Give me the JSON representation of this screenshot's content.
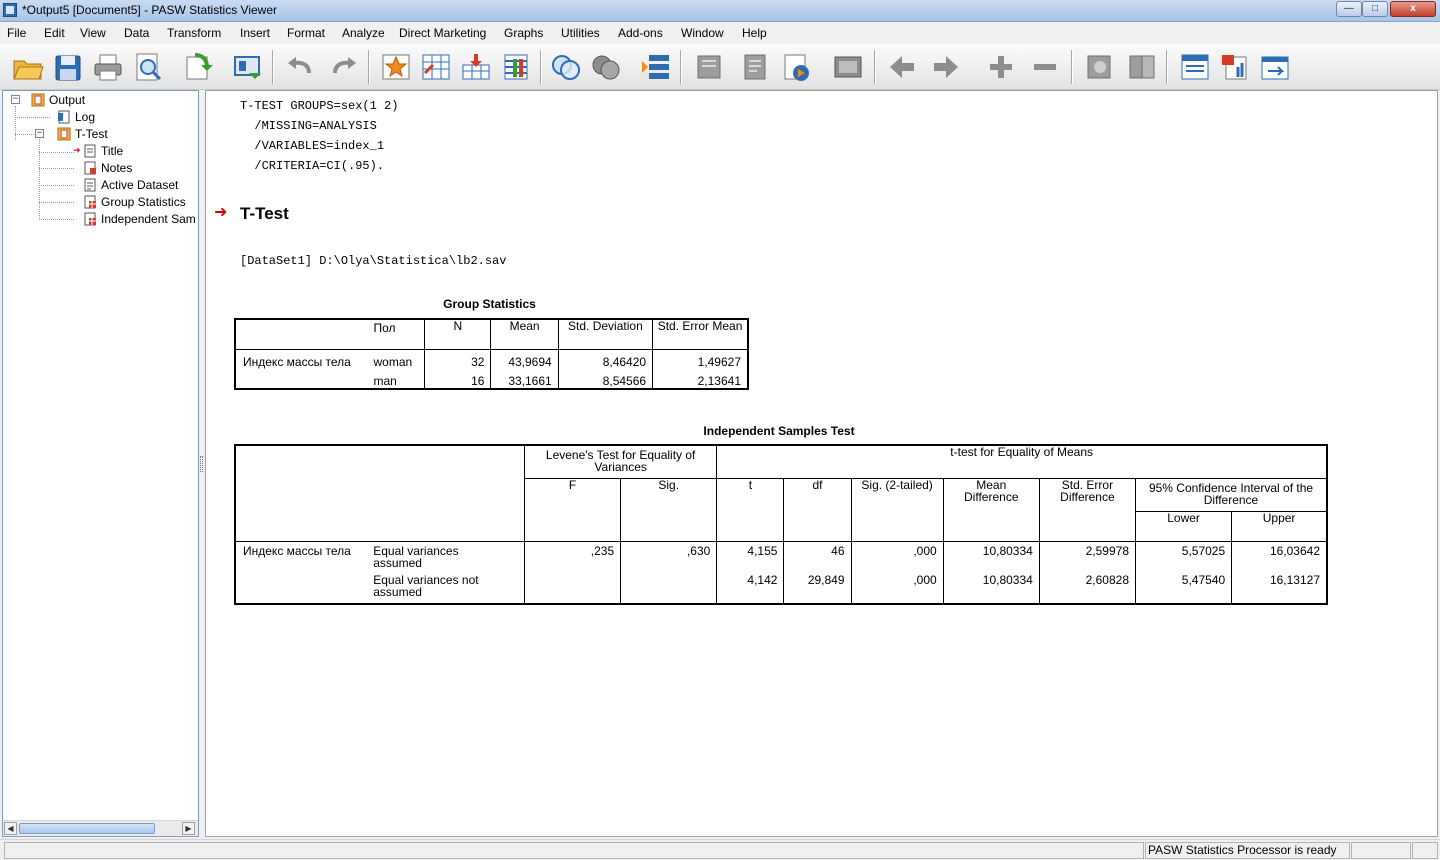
{
  "window": {
    "title": "*Output5 [Document5] - PASW Statistics Viewer",
    "min_glyph": "—",
    "max_glyph": "□",
    "close_glyph": "x"
  },
  "menu": [
    "File",
    "Edit",
    "View",
    "Data",
    "Transform",
    "Insert",
    "Format",
    "Analyze",
    "Direct Marketing",
    "Graphs",
    "Utilities",
    "Add-ons",
    "Window",
    "Help"
  ],
  "toolbar": {
    "icons": [
      "open-icon",
      "save-icon",
      "print-icon",
      "print-preview-icon",
      "export-icon",
      "recall-dialog-icon",
      "undo-icon",
      "redo-icon",
      "goto-data-icon",
      "goto-case-icon",
      "goto-variable-icon",
      "variables-icon",
      "split-file-icon",
      "select-cases-icon",
      "value-labels-icon",
      "custom-dialog-icon",
      "designate-window-icon",
      "promote-icon",
      "demote-icon",
      "expand-icon",
      "collapse-icon",
      "show-icon",
      "hide-icon",
      "insert-heading-icon",
      "insert-title-icon",
      "insert-text-icon"
    ],
    "accent_colors": {
      "orange": "#f08a1c",
      "blue": "#2f6db3",
      "green": "#3c9a32",
      "red": "#d63a2a",
      "gray": "#8d8d8d"
    }
  },
  "outline": {
    "items": [
      {
        "label": "Output",
        "icon": "output-book-icon"
      },
      {
        "label": "Log",
        "icon": "log-icon"
      },
      {
        "label": "T-Test",
        "icon": "procedure-book-icon"
      },
      {
        "label": "Title",
        "icon": "title-icon",
        "current_marker": "➔"
      },
      {
        "label": "Notes",
        "icon": "notes-icon"
      },
      {
        "label": "Active Dataset",
        "icon": "active-dataset-icon"
      },
      {
        "label": "Group Statistics",
        "icon": "table-icon"
      },
      {
        "label": "Independent Sam",
        "icon": "table-icon"
      }
    ],
    "collapse_glyph": "−",
    "scroll_left_glyph": "◀",
    "scroll_right_glyph": "▶"
  },
  "syntax": [
    "T-TEST GROUPS=sex(1 2)",
    "  /MISSING=ANALYSIS",
    "  /VARIABLES=index_1",
    "  /CRITERIA=CI(.95)."
  ],
  "section": {
    "arrow": "➜",
    "title": "T-Test",
    "dataset": "[DataSet1] D:\\Olya\\Statistica\\lb2.sav"
  },
  "group_statistics": {
    "title": "Group Statistics",
    "group_header": "Пол",
    "headers": [
      "N",
      "Mean",
      "Std. Deviation",
      "Std. Error Mean"
    ],
    "row_label": "Индекс массы тела",
    "rows": [
      {
        "group": "woman",
        "n": "32",
        "mean": "43,9694",
        "sd": "8,46420",
        "se": "1,49627"
      },
      {
        "group": "man",
        "n": "16",
        "mean": "33,1661",
        "sd": "8,54566",
        "se": "2,13641"
      }
    ]
  },
  "independent_test": {
    "title": "Independent Samples Test",
    "levene_header": "Levene's Test for Equality of Variances",
    "ttest_header": "t-test for Equality of Means",
    "ci_header": "95% Confidence Interval of the Difference",
    "columns": {
      "f": "F",
      "sig": "Sig.",
      "t": "t",
      "df": "df",
      "sig2": "Sig. (2-tailed)",
      "md": "Mean Difference",
      "sed": "Std. Error Difference",
      "lower": "Lower",
      "upper": "Upper"
    },
    "row_label": "Индекс массы тела",
    "rows": [
      {
        "label": "Equal variances assumed",
        "f": ",235",
        "sig": ",630",
        "t": "4,155",
        "df": "46",
        "sig2": ",000",
        "md": "10,80334",
        "sed": "2,59978",
        "lower": "5,57025",
        "upper": "16,03642"
      },
      {
        "label": "Equal variances not assumed",
        "f": "",
        "sig": "",
        "t": "4,142",
        "df": "29,849",
        "sig2": ",000",
        "md": "10,80334",
        "sed": "2,60828",
        "lower": "5,47540",
        "upper": "16,13127"
      }
    ]
  },
  "status": {
    "text": "PASW Statistics Processor is ready"
  }
}
